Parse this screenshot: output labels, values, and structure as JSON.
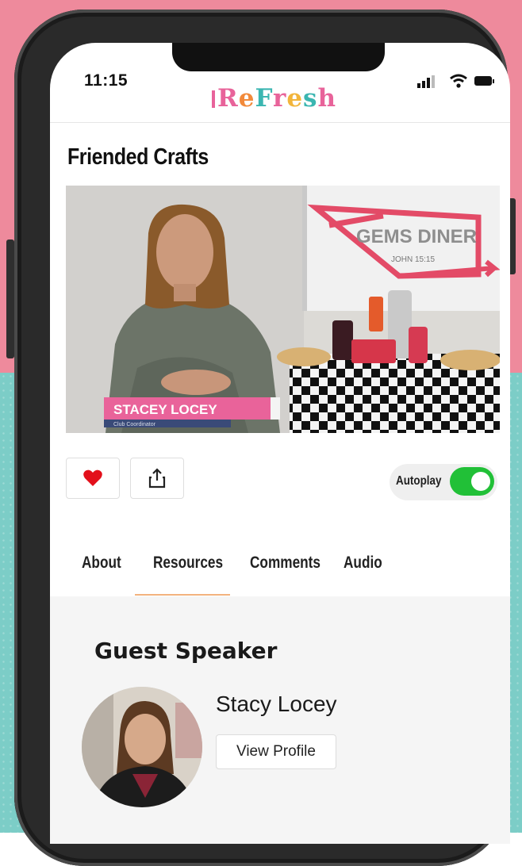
{
  "status_bar": {
    "time": "11:15"
  },
  "header": {
    "logo_text": "ReFresh",
    "logo_letters": [
      "R",
      "e",
      "F",
      "r",
      "e",
      "s",
      "h"
    ],
    "logo_colors": [
      "#e8639a",
      "#f28a3b",
      "#3bb6b1",
      "#e8639a",
      "#f2b53b",
      "#3bb6b1",
      "#e8639a"
    ]
  },
  "video": {
    "title": "Friended Crafts",
    "lower_third_name": "STACEY LOCEY",
    "lower_third_role": "Club Coordinator",
    "sign_title": "GEMS DINER",
    "sign_verse": "JOHN 15:15"
  },
  "actions": {
    "like_icon": "heart-icon",
    "share_icon": "share-icon",
    "autoplay_label": "Autoplay",
    "autoplay_on": true
  },
  "tabs": [
    {
      "label": "About"
    },
    {
      "label": "Resources",
      "active": true
    },
    {
      "label": "Comments"
    },
    {
      "label": "Audio"
    }
  ],
  "guest": {
    "section_title": "Guest Speaker",
    "name": "Stacy Locey",
    "button_label": "View Profile"
  },
  "colors": {
    "like": "#e3101b",
    "toggle_on": "#21c037",
    "tab_underline": "#f2b27e",
    "background_top": "#ee8a9c",
    "background_bottom": "#7ccdc7"
  }
}
